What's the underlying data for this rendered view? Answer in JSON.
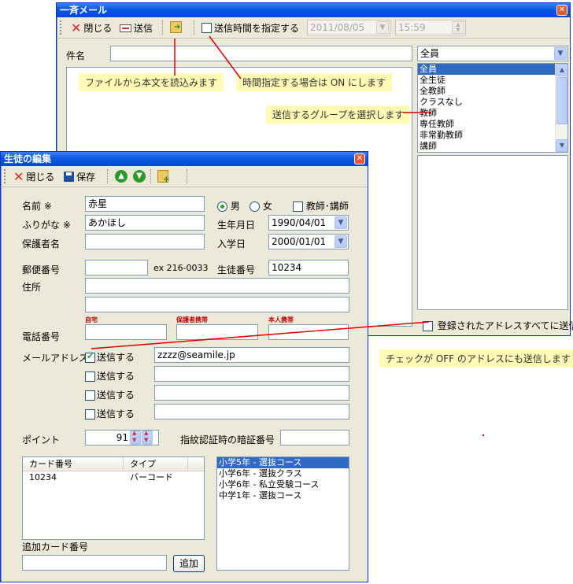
{
  "mail_window": {
    "title": "一斉メール",
    "toolbar": {
      "close_label": "閉じる",
      "send_label": "送信",
      "schedule_label": "送信時間を指定する",
      "date_value": "2011/08/05",
      "time_value": "15:59"
    },
    "subject_label": "件名",
    "subject_value": "",
    "group_select_value": "全員",
    "group_list": [
      "全員",
      "全生徒",
      "全教師",
      "クラスなし",
      "教師",
      "専任教師",
      "非常勤教師",
      "講師"
    ],
    "send_all_label": "登録されたアドレスすべてに送信"
  },
  "annotations": {
    "load_body": "ファイルから本文を読込みます",
    "time_spec": "時間指定する場合は ON にします",
    "select_group": "送信するグループを選択します",
    "send_off": "チェックが OFF のアドレスにも送信します"
  },
  "student_window": {
    "title": "生徒の編集",
    "toolbar": {
      "close_label": "閉じる",
      "save_label": "保存"
    },
    "name_label": "名前 ※",
    "name_value": "赤星",
    "furigana_label": "ふりがな ※",
    "furigana_value": "あかほし",
    "guardian_label": "保護者名",
    "guardian_value": "",
    "gender_male": "男",
    "gender_female": "女",
    "teacher_label": "教師･講師",
    "birthdate_label": "生年月日",
    "birthdate_value": "1990/04/01",
    "enroll_label": "入学日",
    "enroll_value": "2000/01/01",
    "postal_label": "郵便番号",
    "postal_value": "",
    "postal_example": "ex 216-0033",
    "student_no_label": "生徒番号",
    "student_no_value": "10234",
    "address_label": "住所",
    "address_line1": "",
    "address_line2": "",
    "phone_label": "電話番号",
    "phone_home_caption": "自宅",
    "phone_guardian_caption": "保護者携帯",
    "phone_self_caption": "本人携帯",
    "mail_label": "メールアドレス",
    "mail_send_label": "送信する",
    "mail_rows": [
      {
        "checked": true,
        "value": "zzzz@seamile.jp"
      },
      {
        "checked": false,
        "value": ""
      },
      {
        "checked": false,
        "value": ""
      },
      {
        "checked": false,
        "value": ""
      }
    ],
    "point_label": "ポイント",
    "point_value": "91",
    "pin_label": "指紋認証時の暗証番号",
    "pin_value": "",
    "card_table": {
      "col_card": "カード番号",
      "col_type": "タイプ",
      "rows": [
        {
          "card": "10234",
          "type": "バーコード"
        }
      ]
    },
    "courses": [
      "小学5年 - 選抜コース",
      "小学6年 - 選抜クラス",
      "小学6年 - 私立受験コース",
      "中学1年 - 選抜コース"
    ],
    "add_card_label": "追加カード番号",
    "add_card_value": "",
    "add_button": "追加"
  },
  "colors": {
    "titlebar": "#0a58e0",
    "window_bg": "#ece9d8",
    "annotation_bg": "#fffbb5",
    "annotation_line": "#e00000",
    "selection": "#316ac5"
  }
}
